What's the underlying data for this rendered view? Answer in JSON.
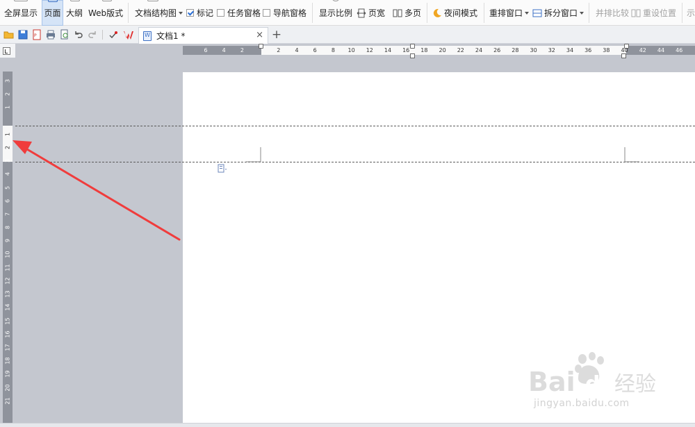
{
  "ribbon": {
    "fullscreen": "全屏显示",
    "page_view": "页面",
    "outline": "大纲",
    "web_layout": "Web版式",
    "doc_map": "文档结构图",
    "markup": "标记",
    "task_pane": "任务窗格",
    "nav_pane": "导航窗格",
    "zoom": "显示比例",
    "page_width": "页宽",
    "multi_page": "多页",
    "night_mode": "夜间模式",
    "arrange_windows": "重排窗口",
    "split_window": "拆分窗口",
    "side_by_side": "并排比较",
    "reset_position": "重设位置",
    "overflow_char": "示"
  },
  "tabs": [
    {
      "title": "文档1 *"
    }
  ],
  "tab_close": "×",
  "new_tab": "+",
  "hruler_labels": [
    "6",
    "4",
    "2",
    "",
    "2",
    "4",
    "6",
    "8",
    "10",
    "12",
    "14",
    "16",
    "18",
    "20",
    "22",
    "24",
    "26",
    "28",
    "30",
    "32",
    "34",
    "36",
    "38",
    "40",
    "42",
    "44",
    "46"
  ],
  "vruler_labels": [
    "3",
    "2",
    "1",
    "",
    "1",
    "2",
    "3",
    "4",
    "5",
    "6",
    "7",
    "8",
    "9",
    "10",
    "11",
    "12",
    "13",
    "14",
    "15",
    "16",
    "17",
    "18",
    "19",
    "20",
    "21"
  ],
  "watermark": {
    "brand": "Bai",
    "brand2": "du",
    "cn": "经验",
    "url": "jingyan.baidu.com"
  },
  "colors": {
    "accent": "#2a6fd6",
    "arrow": "#f03c3c",
    "ruler_gray": "#8f939c",
    "workspace": "#c4c7cf"
  }
}
